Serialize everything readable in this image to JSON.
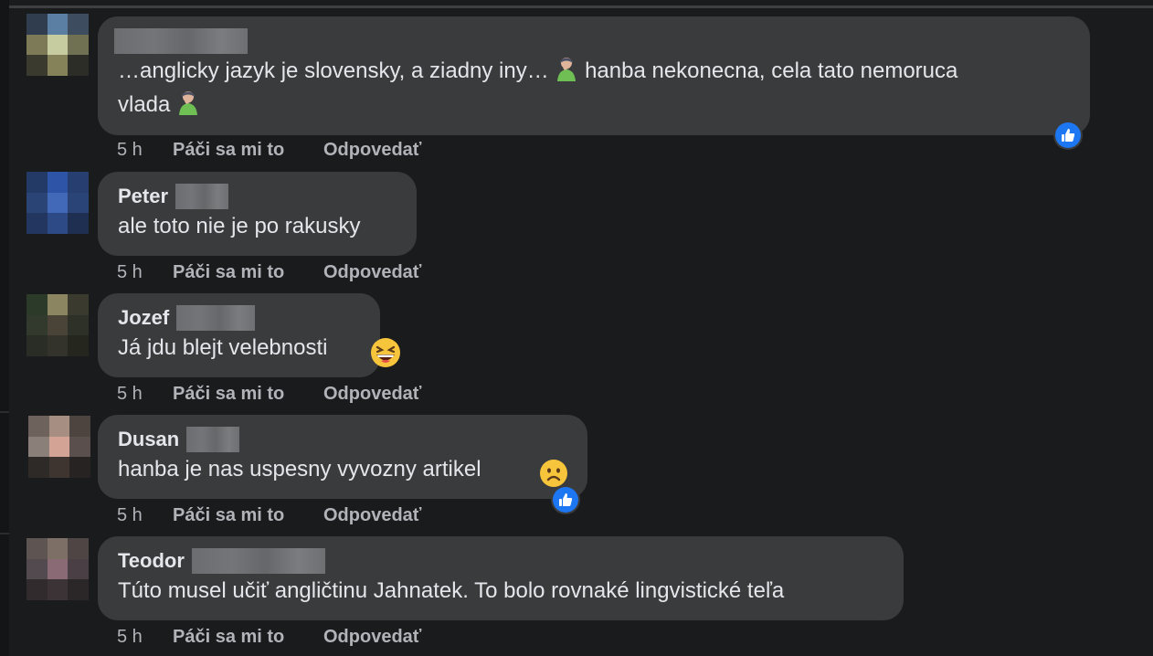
{
  "thread": {
    "comments": [
      {
        "author": "",
        "text_before": "…anglicky jazyk je slovensky, a ziadny iny… ",
        "text_middle": " hanba nekonecna, cela tato nemoruca",
        "text_line2": "vlada ",
        "inline_icons": [
          "person-facepalming-icon",
          "person-facepalming-icon"
        ],
        "time": "5 h",
        "like_label": "Páči sa mi to",
        "reply_label": "Odpovedať",
        "reaction": "like-reaction-icon"
      },
      {
        "author": "Peter",
        "text": "ale toto nie je po rakusky",
        "time": "5 h",
        "like_label": "Páči sa mi to",
        "reply_label": "Odpovedať"
      },
      {
        "author": "Jozef",
        "text": "Já jdu blejt velebnosti ",
        "inline_icons": [
          "grinning-squinting-face-icon"
        ],
        "time": "5 h",
        "like_label": "Páči sa mi to",
        "reply_label": "Odpovedať"
      },
      {
        "author": "Dusan",
        "text": "hanba je nas uspesny vyvozny artikel ",
        "inline_icons": [
          "frowning-face-icon"
        ],
        "time": "5 h",
        "like_label": "Páči sa mi to",
        "reply_label": "Odpovedať",
        "reaction": "like-reaction-icon"
      },
      {
        "author": "Teodor",
        "text": "Túto musel učiť angličtinu Jahnatek. To bolo rovnaké lingvistické teľa",
        "time": "5 h",
        "like_label": "Páči sa mi to",
        "reply_label": "Odpovedať"
      }
    ]
  },
  "colors": {
    "background": "#1a1b1d",
    "bubble": "#3a3b3c",
    "text": "#e4e6eb",
    "secondary_text": "#b0b3b8",
    "like_blue": "#1d77f2"
  }
}
